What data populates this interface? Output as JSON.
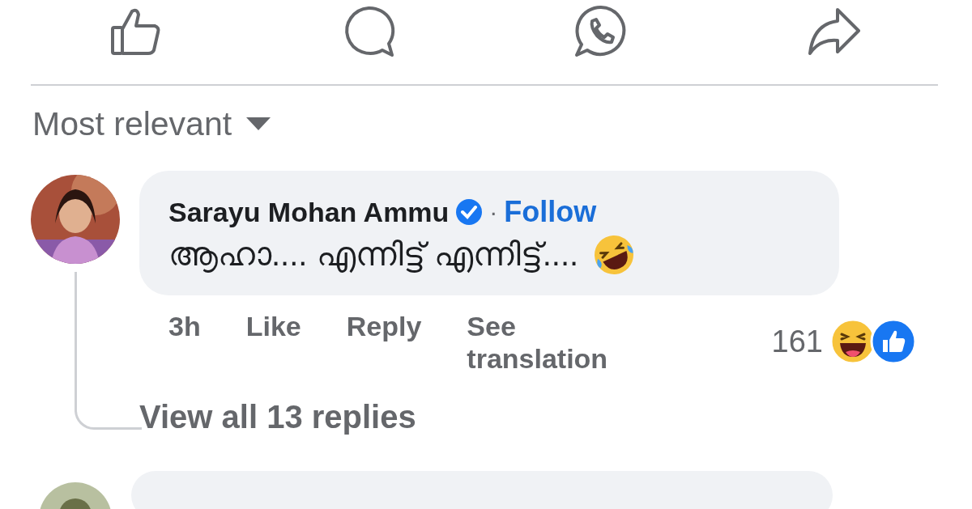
{
  "action_bar": [
    {
      "kind": "like"
    },
    {
      "kind": "comment"
    },
    {
      "kind": "whatsapp"
    },
    {
      "kind": "share"
    }
  ],
  "sort": {
    "label": "Most relevant"
  },
  "comments": [
    {
      "author": "Sarayu Mohan Ammu",
      "verified": true,
      "separator": "·",
      "follow": "Follow",
      "text": "ആഹാ.... എന്നിട്ട് എന്നിട്ട്....",
      "emoji": {
        "kind": "rolling-laughing"
      },
      "time": "3h",
      "actions": [
        "Like",
        "Reply",
        "See translation"
      ],
      "reaction_count": "161",
      "reactions": [
        {
          "kind": "haha"
        },
        {
          "kind": "like"
        }
      ],
      "view_replies": "View all 13 replies"
    }
  ],
  "partial_comment_below": true
}
